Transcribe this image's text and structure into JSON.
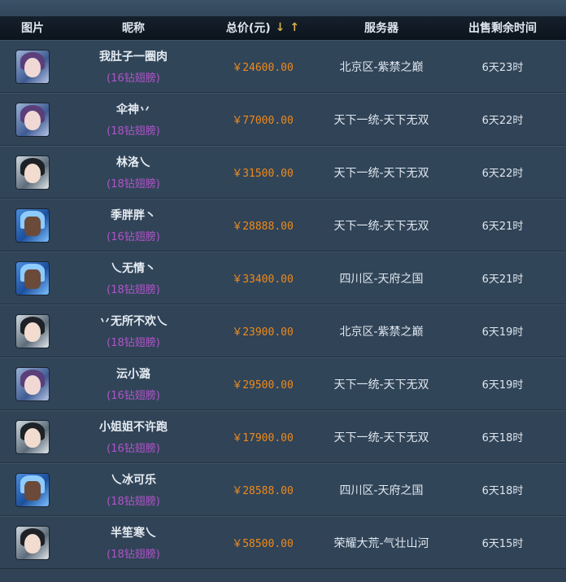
{
  "header": {
    "img": "图片",
    "name": "昵称",
    "price": "总价(元)",
    "sort_down": "↓",
    "sort_up": "↑",
    "server": "服务器",
    "time": "出售剩余时间"
  },
  "rows": [
    {
      "avatar": "purple",
      "name": "我肚子一圈肉",
      "diamond": "(16钻翅膀)",
      "price": "￥24600.00",
      "server": "北京区-紫禁之巅",
      "time": "6天23时"
    },
    {
      "avatar": "purple",
      "name": "伞神丷",
      "diamond": "(18钻翅膀)",
      "price": "￥77000.00",
      "server": "天下一统-天下无双",
      "time": "6天22时"
    },
    {
      "avatar": "dark",
      "name": "林洛乀",
      "diamond": "(18钻翅膀)",
      "price": "￥31500.00",
      "server": "天下一统-天下无双",
      "time": "6天22时"
    },
    {
      "avatar": "blue",
      "name": "季胖胖丶",
      "diamond": "(16钻翅膀)",
      "price": "￥28888.00",
      "server": "天下一统-天下无双",
      "time": "6天21时"
    },
    {
      "avatar": "blue",
      "name": "乀无情丶",
      "diamond": "(18钻翅膀)",
      "price": "￥33400.00",
      "server": "四川区-天府之国",
      "time": "6天21时"
    },
    {
      "avatar": "dark",
      "name": "丷无所不欢乀",
      "diamond": "(18钻翅膀)",
      "price": "￥23900.00",
      "server": "北京区-紫禁之巅",
      "time": "6天19时"
    },
    {
      "avatar": "purple",
      "name": "沄小潞",
      "diamond": "(16钻翅膀)",
      "price": "￥29500.00",
      "server": "天下一统-天下无双",
      "time": "6天19时"
    },
    {
      "avatar": "dark",
      "name": "小姐姐不许跑",
      "diamond": "(16钻翅膀)",
      "price": "￥17900.00",
      "server": "天下一统-天下无双",
      "time": "6天18时"
    },
    {
      "avatar": "blue",
      "name": "乀冰可乐",
      "diamond": "(18钻翅膀)",
      "price": "￥28588.00",
      "server": "四川区-天府之国",
      "time": "6天18时"
    },
    {
      "avatar": "dark",
      "name": "半笙寒乀",
      "diamond": "(18钻翅膀)",
      "price": "￥58500.00",
      "server": "荣耀大荒-气壮山河",
      "time": "6天15时"
    }
  ]
}
